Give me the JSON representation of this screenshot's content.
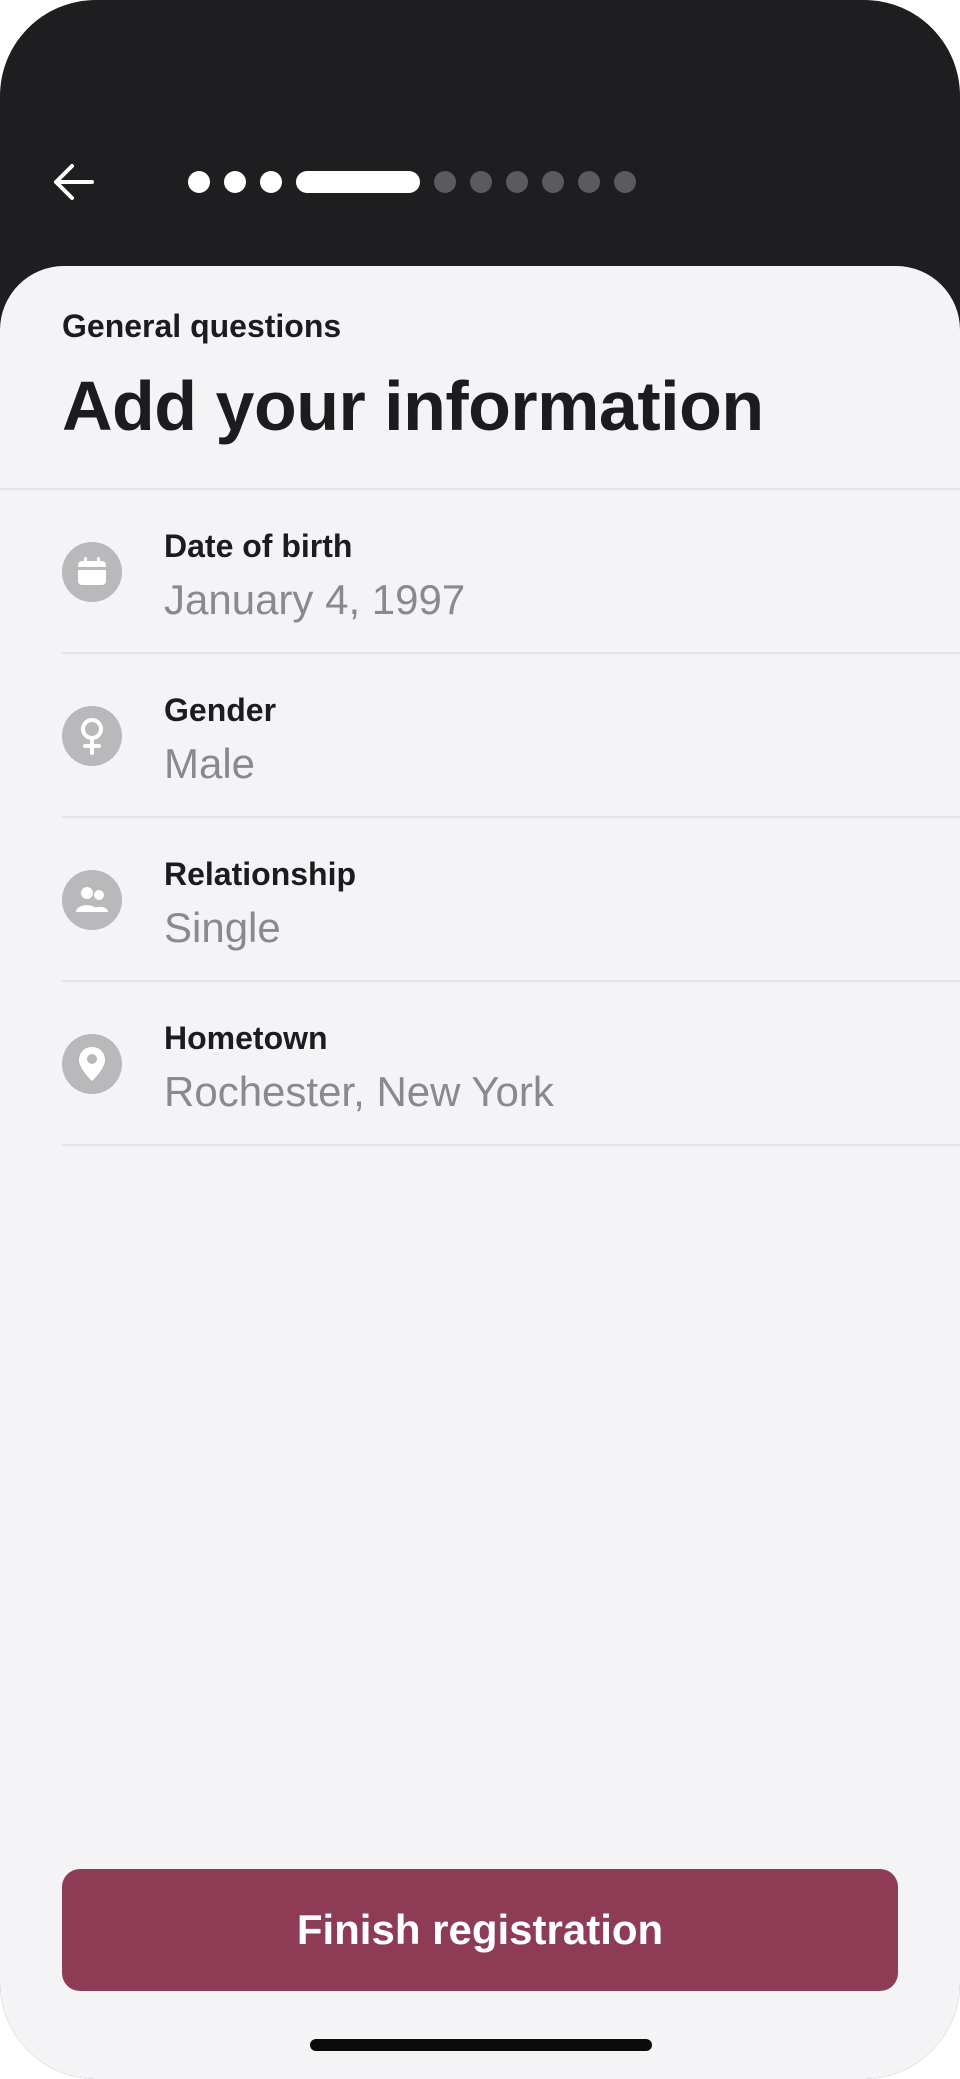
{
  "header": {
    "back_icon": "arrow-left-icon",
    "progress": {
      "completed_steps": 3,
      "current_step": 4,
      "total_steps": 10
    }
  },
  "content": {
    "eyebrow": "General questions",
    "title": "Add your information"
  },
  "fields": [
    {
      "icon": "calendar-icon",
      "label": "Date of birth",
      "value": "January 4, 1997"
    },
    {
      "icon": "gender-icon",
      "label": "Gender",
      "value": "Male"
    },
    {
      "icon": "people-icon",
      "label": "Relationship",
      "value": "Single"
    },
    {
      "icon": "location-pin-icon",
      "label": "Hometown",
      "value": "Rochester, New York"
    }
  ],
  "footer": {
    "cta_label": "Finish registration"
  },
  "colors": {
    "header_bg": "#1e1e20",
    "sheet_bg": "#f4f4f6",
    "accent": "#8e3b55",
    "icon_bg": "#b9b9bc"
  }
}
